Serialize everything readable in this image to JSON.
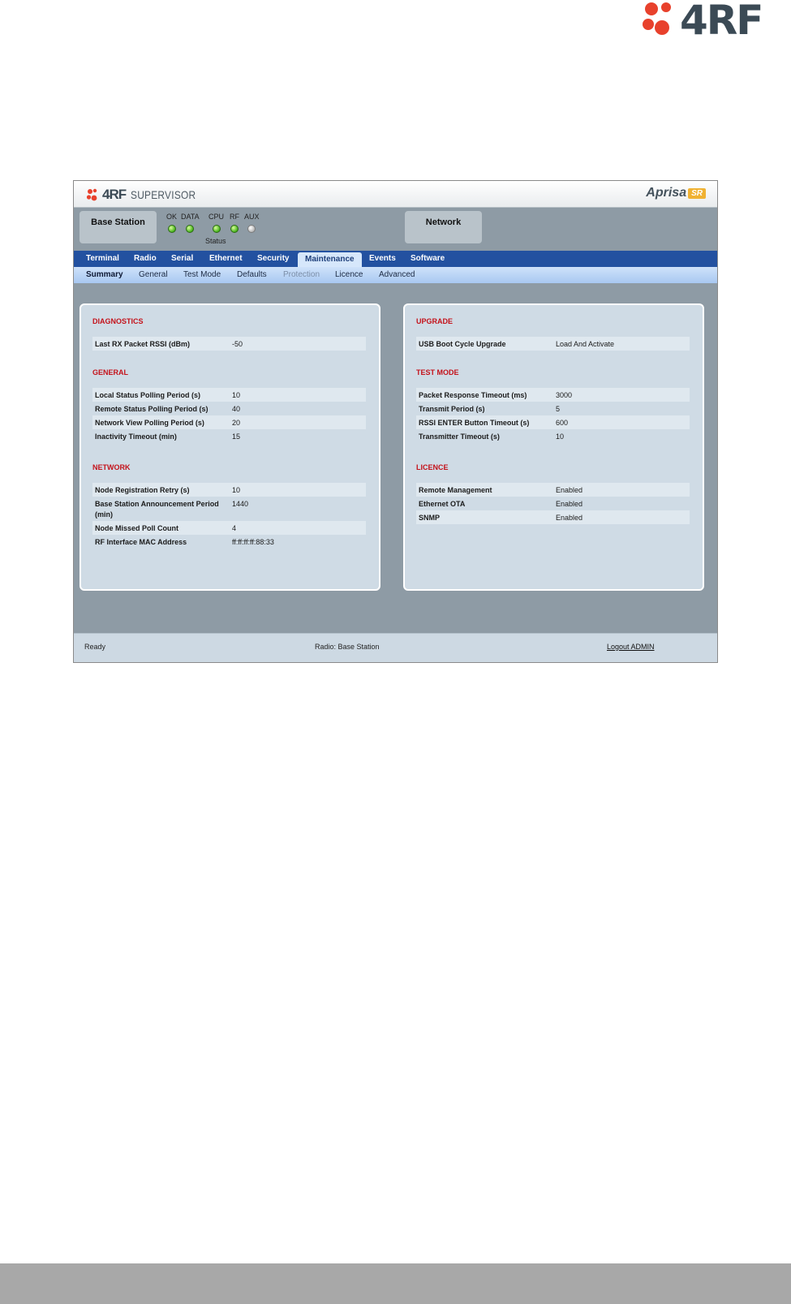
{
  "page_logo": {
    "text": "4RF"
  },
  "titlebar": {
    "brand": "4RF",
    "product": "SUPERVISOR",
    "aprisa": "Aprisa",
    "aprisa_badge": "SR"
  },
  "header": {
    "station_box": "Base Station",
    "network_box": "Network",
    "leds": [
      {
        "label": "OK",
        "state": "on"
      },
      {
        "label": "DATA",
        "state": "on"
      },
      {
        "label": "CPU",
        "state": "on"
      },
      {
        "label": "RF",
        "state": "on"
      },
      {
        "label": "AUX",
        "state": "off"
      }
    ],
    "status_label": "Status"
  },
  "nav": {
    "tabs": [
      "Terminal",
      "Radio",
      "Serial",
      "Ethernet",
      "Security",
      "Maintenance",
      "Events",
      "Software"
    ],
    "active": "Maintenance"
  },
  "subnav": {
    "tabs": [
      "Summary",
      "General",
      "Test Mode",
      "Defaults",
      "Protection",
      "Licence",
      "Advanced"
    ],
    "active": "Summary",
    "disabled": "Protection"
  },
  "left_panel": {
    "diagnostics": {
      "title": "DIAGNOSTICS",
      "rows": [
        {
          "k": "Last RX Packet RSSI (dBm)",
          "v": "-50"
        }
      ]
    },
    "general": {
      "title": "GENERAL",
      "rows": [
        {
          "k": "Local Status Polling Period (s)",
          "v": "10"
        },
        {
          "k": "Remote Status Polling Period (s)",
          "v": "40"
        },
        {
          "k": "Network View Polling Period (s)",
          "v": "20"
        },
        {
          "k": "Inactivity Timeout (min)",
          "v": "15"
        }
      ]
    },
    "network": {
      "title": "NETWORK",
      "rows": [
        {
          "k": "Node Registration Retry (s)",
          "v": "10"
        },
        {
          "k": "Base Station Announcement Period (min)",
          "v": "1440"
        },
        {
          "k": "Node Missed Poll Count",
          "v": "4"
        },
        {
          "k": "RF Interface MAC Address",
          "v": "ff:ff:ff:ff:88:33"
        }
      ]
    }
  },
  "right_panel": {
    "upgrade": {
      "title": "UPGRADE",
      "rows": [
        {
          "k": "USB Boot Cycle Upgrade",
          "v": "Load And Activate"
        }
      ]
    },
    "test_mode": {
      "title": "TEST MODE",
      "rows": [
        {
          "k": "Packet Response Timeout (ms)",
          "v": "3000"
        },
        {
          "k": "Transmit Period (s)",
          "v": "5"
        },
        {
          "k": "RSSI ENTER Button Timeout (s)",
          "v": "600"
        },
        {
          "k": "Transmitter Timeout (s)",
          "v": "10"
        }
      ]
    },
    "licence": {
      "title": "LICENCE",
      "rows": [
        {
          "k": "Remote Management",
          "v": "Enabled"
        },
        {
          "k": "Ethernet OTA",
          "v": "Enabled"
        },
        {
          "k": "SNMP",
          "v": "Enabled"
        }
      ]
    }
  },
  "footer": {
    "status": "Ready",
    "radio": "Radio: Base Station",
    "logout": "Logout ADMIN"
  },
  "colors": {
    "nav_blue": "#2351a0",
    "section_red": "#c4121a",
    "logo_red": "#e8412c",
    "led_green": "#46b21d"
  }
}
